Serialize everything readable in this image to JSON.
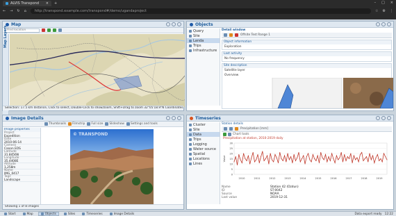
{
  "browser": {
    "tab_title": "ALVIS Transpond",
    "url": "http://transpond.example.com/transpond#/demo/ugandaproject"
  },
  "map_panel": {
    "title": "Map",
    "vertical_tab": "Map Layers",
    "search_placeholder": "Find location",
    "status": "Selection: 17.5 km distance, Click to select, Double-Click to show/zoom, Shift+Drag to zoom    32°05'18.9\"N  Coordinates"
  },
  "objects_panel": {
    "title": "Objects",
    "tree": [
      {
        "label": "Query",
        "selected": false
      },
      {
        "label": "Site",
        "selected": false
      },
      {
        "label": "Landa",
        "selected": true
      },
      {
        "label": "Trips",
        "selected": false
      },
      {
        "label": "Infrastructure",
        "selected": false
      }
    ],
    "detail_title": "Detail window",
    "detail_toolbar_text": "Offsite Test Range 1",
    "sec1_header": "Object information",
    "sec1_value": "Exploration",
    "sec2_header": "Last activity",
    "sec2_value": "No frequency",
    "sec3_header": "Site description",
    "sec3_sub": "Satellite layer",
    "sec3_value": "Overview"
  },
  "image_panel": {
    "title": "Image Details",
    "toolbar_items": [
      "Thumbnails",
      "Filmstrip",
      "Full size",
      "Slideshow",
      "Settings and tools"
    ],
    "side_header": "Image properties",
    "side_rows": [
      {
        "k": "Project",
        "v": "Expedition"
      },
      {
        "k": "Date",
        "v": "2010-06-14"
      },
      {
        "k": "Camera",
        "v": "Canon EOS"
      },
      {
        "k": "Latitude",
        "v": "31.8456N"
      },
      {
        "k": "Longitude",
        "v": "35.4408E"
      },
      {
        "k": "Altitude",
        "v": "1,258m"
      },
      {
        "k": "Name",
        "v": "IMG_0417"
      },
      {
        "k": "Tags",
        "v": "Landscape"
      }
    ],
    "watermark": "© TRANSPOND",
    "status": "Showing 1 of 8 images"
  },
  "timeseries_panel": {
    "title": "Timeseries",
    "tree": [
      {
        "label": "Cluster",
        "selected": false
      },
      {
        "label": "Site",
        "selected": false
      },
      {
        "label": "Data",
        "selected": true
      },
      {
        "label": "Trips",
        "selected": false
      },
      {
        "label": "Logging",
        "selected": false
      },
      {
        "label": "Water source",
        "selected": false
      },
      {
        "label": "Spatial",
        "selected": false
      },
      {
        "label": "Locations",
        "selected": false
      },
      {
        "label": "Lines",
        "selected": false
      }
    ],
    "detail_tab": "Station details",
    "toolbar_text": "Precipitation [mm]",
    "chart_toolbar": "Chart tools",
    "chart_caption": "Precipitation at station, 2010-2019 daily",
    "info_rows": [
      {
        "k": "Name",
        "v": "Station 42 (Ozdun)"
      },
      {
        "k": "ID",
        "v": "ST-0042"
      },
      {
        "k": "Source",
        "v": "NOAA"
      },
      {
        "k": "Last value",
        "v": "2019-12-31"
      }
    ]
  },
  "taskbar": {
    "items": [
      "Start",
      "Map",
      "Objects",
      "Sites",
      "Timeseries",
      "Image Details"
    ],
    "right_text": "Data export ready",
    "clock": "12:22"
  },
  "chart_data": {
    "type": "line",
    "title": "",
    "xlabel": "",
    "ylabel": "Value",
    "x_ticks": [
      "2010",
      "2011",
      "2012",
      "2013",
      "2014",
      "2015",
      "2016",
      "2017",
      "2018",
      "2019"
    ],
    "ylim": [
      0,
      30
    ],
    "y_ticks": [
      0,
      5,
      10,
      15,
      20,
      25,
      30
    ],
    "series": [
      {
        "color": "#c0392b",
        "values": [
          12,
          17,
          9,
          19,
          14,
          11,
          20,
          15,
          13,
          18,
          10,
          16,
          21,
          12,
          14,
          19,
          11,
          17,
          22,
          13,
          15,
          18,
          10,
          20,
          14,
          12,
          19,
          16,
          11,
          21,
          15,
          13,
          18,
          12,
          20,
          14,
          17,
          11,
          19,
          13,
          16,
          21,
          12,
          15,
          18,
          10,
          17,
          20,
          14,
          12,
          19,
          15,
          13,
          18,
          11,
          21,
          16,
          14,
          19,
          12,
          17,
          13,
          20,
          15,
          11,
          18,
          14,
          16,
          21,
          12,
          19,
          13,
          17,
          15,
          20,
          11,
          18,
          14,
          16,
          12,
          19,
          21,
          13,
          15,
          17,
          12,
          20,
          14,
          18,
          11,
          16,
          19,
          13,
          15,
          12,
          20,
          17,
          14
        ]
      }
    ]
  }
}
